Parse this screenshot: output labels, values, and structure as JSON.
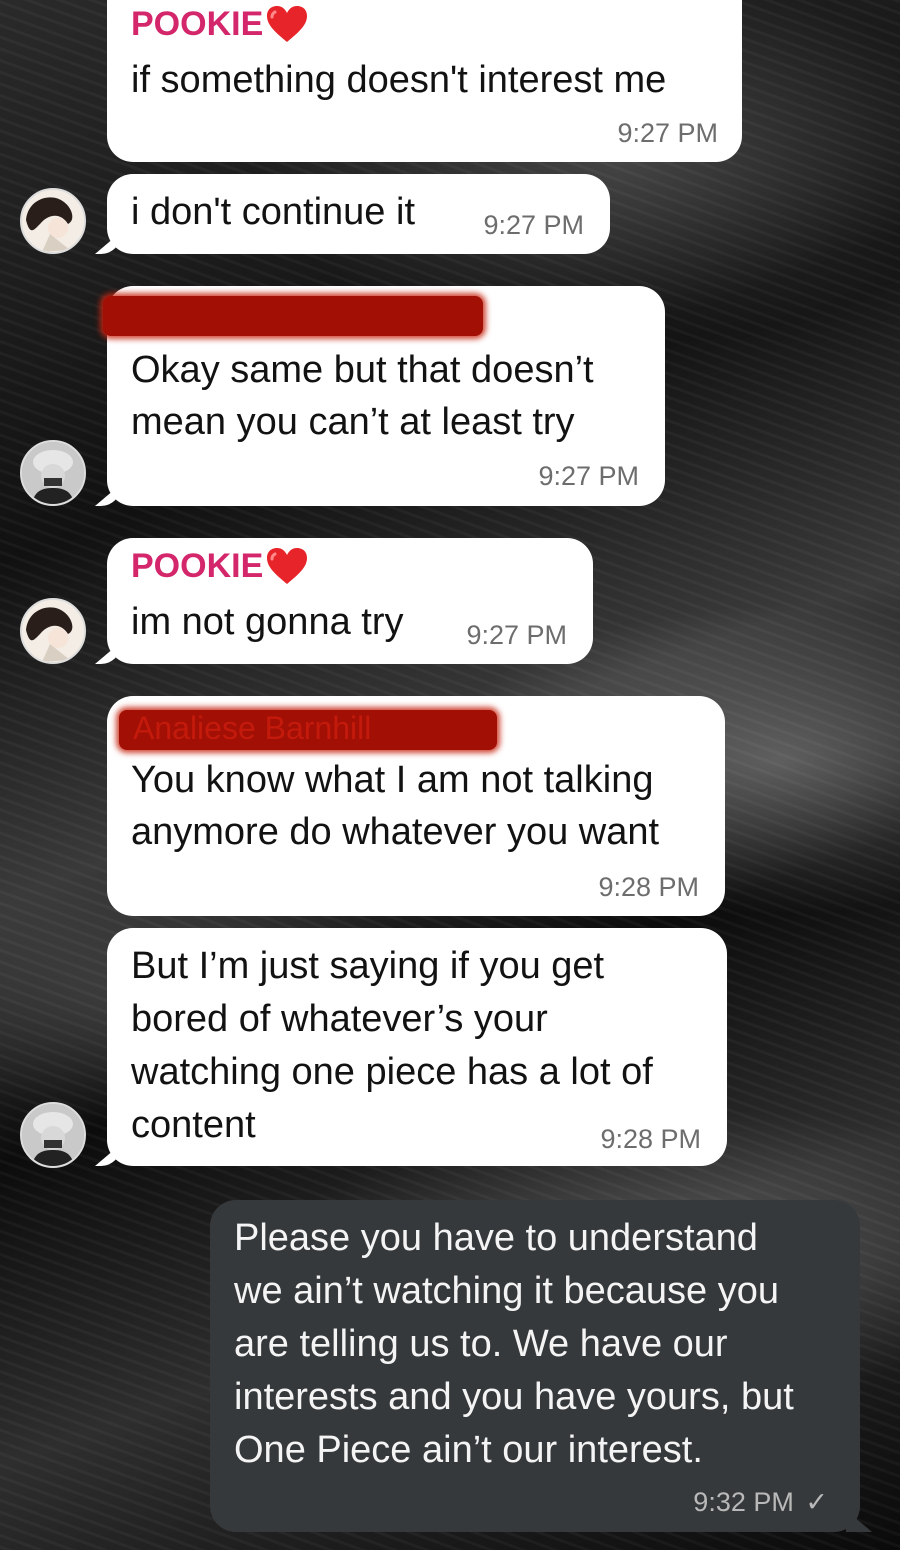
{
  "messages": [
    {
      "sender": "POOKIE",
      "text": [
        "if something doesn't interest me"
      ],
      "time": "9:27 PM"
    },
    {
      "sender": "",
      "text": [
        "i don't continue it"
      ],
      "time": "9:27 PM"
    },
    {
      "sender": "",
      "text": [
        "Okay same but that doesn’t",
        "mean you can’t at least try"
      ],
      "time": "9:27 PM"
    },
    {
      "sender": "POOKIE",
      "text": [
        "im not gonna try"
      ],
      "time": "9:27 PM"
    },
    {
      "sender": "Analiese Barnhill",
      "text": [
        "You know what I am not talking",
        "anymore do whatever you want"
      ],
      "time": "9:28 PM"
    },
    {
      "sender": "",
      "text": [
        "But I’m just saying if you get",
        "bored of whatever’s your",
        "watching one piece has a lot of",
        "content"
      ],
      "time": "9:28 PM"
    },
    {
      "sender": "",
      "text": [
        "Please you have to understand",
        "we ain’t watching it because you",
        "are telling us to. We have our",
        "interests and you have yours, but",
        "One Piece ain’t our interest."
      ],
      "time": "9:32 PM",
      "status": "✓"
    }
  ],
  "colors": {
    "sender_name": "#d4266b",
    "outgoing_bubble": "#36393b",
    "incoming_bubble": "#ffffff",
    "redaction": "#a20f05"
  }
}
